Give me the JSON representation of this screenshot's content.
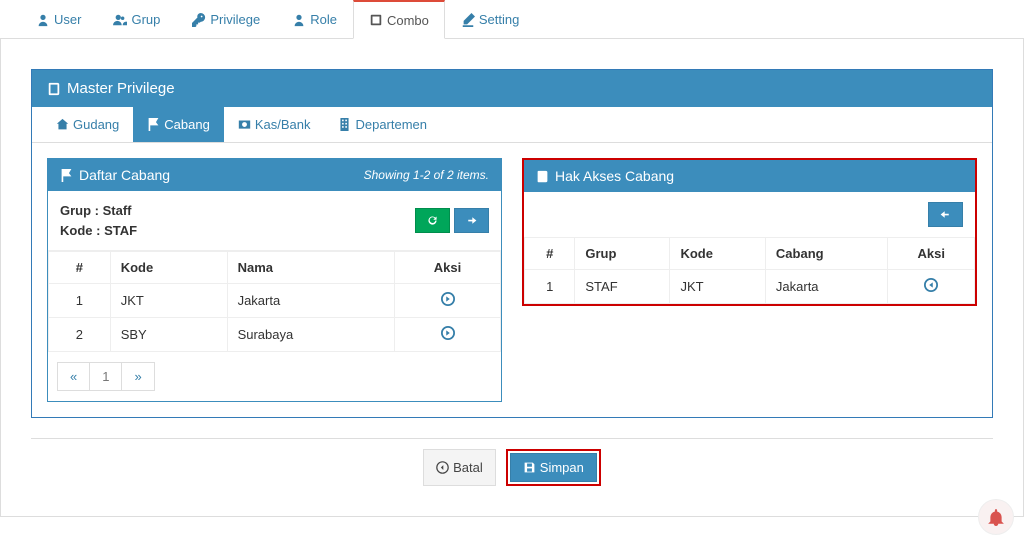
{
  "nav": {
    "tabs": [
      {
        "label": "User"
      },
      {
        "label": "Grup"
      },
      {
        "label": "Privilege"
      },
      {
        "label": "Role"
      },
      {
        "label": "Combo"
      },
      {
        "label": "Setting"
      }
    ],
    "active_index": 4
  },
  "panel": {
    "title": "Master Privilege",
    "subtabs": [
      {
        "label": "Gudang"
      },
      {
        "label": "Cabang"
      },
      {
        "label": "Kas/Bank"
      },
      {
        "label": "Departemen"
      }
    ],
    "subtab_active_index": 1
  },
  "left_box": {
    "title": "Daftar Cabang",
    "summary": "Showing 1-2 of 2 items.",
    "grup_label": "Grup :",
    "grup_value": "Staff",
    "kode_label": "Kode :",
    "kode_value": "STAF",
    "columns": [
      "#",
      "Kode",
      "Nama",
      "Aksi"
    ],
    "rows": [
      {
        "num": "1",
        "kode": "JKT",
        "nama": "Jakarta"
      },
      {
        "num": "2",
        "kode": "SBY",
        "nama": "Surabaya"
      }
    ],
    "pagination": {
      "prev": "«",
      "pages": [
        "1"
      ],
      "next": "»"
    }
  },
  "right_box": {
    "title": "Hak Akses Cabang",
    "columns": [
      "#",
      "Grup",
      "Kode",
      "Cabang",
      "Aksi"
    ],
    "rows": [
      {
        "num": "1",
        "grup": "STAF",
        "kode": "JKT",
        "cabang": "Jakarta"
      }
    ]
  },
  "footer": {
    "batal_label": "Batal",
    "simpan_label": "Simpan"
  }
}
